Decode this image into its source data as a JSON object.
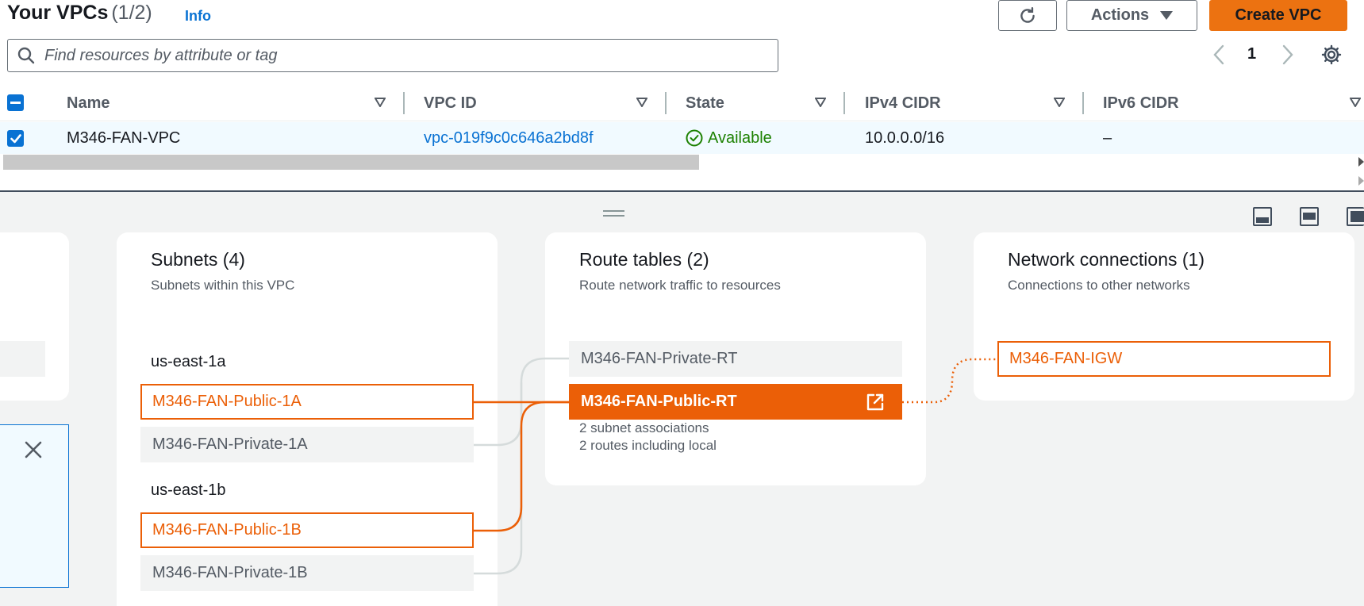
{
  "header": {
    "title": "Your VPCs",
    "count": "(1/2)",
    "info_label": "Info",
    "actions_label": "Actions",
    "create_label": "Create VPC",
    "icons": {
      "refresh": "refresh-icon",
      "caret": "caret-down-icon"
    }
  },
  "search": {
    "placeholder": "Find resources by attribute or tag",
    "value": ""
  },
  "pagination": {
    "current_page": "1"
  },
  "table": {
    "columns": [
      "Name",
      "VPC ID",
      "State",
      "IPv4 CIDR",
      "IPv6 CIDR"
    ],
    "rows": [
      {
        "name": "M346-FAN-VPC",
        "vpc_id": "vpc-019f9c0c646a2bd8f",
        "state": "Available",
        "ipv4": "10.0.0.0/16",
        "ipv6": "–",
        "selected": true
      }
    ]
  },
  "resource_map": {
    "subnets": {
      "title": "Subnets (4)",
      "subtitle": "Subnets within this VPC",
      "zones": [
        {
          "name": "us-east-1a",
          "subnets": [
            "M346-FAN-Public-1A",
            "M346-FAN-Private-1A"
          ]
        },
        {
          "name": "us-east-1b",
          "subnets": [
            "M346-FAN-Public-1B",
            "M346-FAN-Private-1B"
          ]
        }
      ]
    },
    "route_tables": {
      "title": "Route tables (2)",
      "subtitle": "Route network traffic to resources",
      "items": [
        "M346-FAN-Private-RT",
        "M346-FAN-Public-RT"
      ],
      "selected_details": [
        "2 subnet associations",
        "2 routes including local"
      ]
    },
    "network_connections": {
      "title": "Network connections (1)",
      "subtitle": "Connections to other networks",
      "items": [
        "M346-FAN-IGW"
      ]
    }
  },
  "colors": {
    "accent_orange": "#eb5f07",
    "button_orange": "#ec7211",
    "link_blue": "#0972d3",
    "status_green": "#1d8102",
    "panel_bg": "#f2f3f3"
  }
}
